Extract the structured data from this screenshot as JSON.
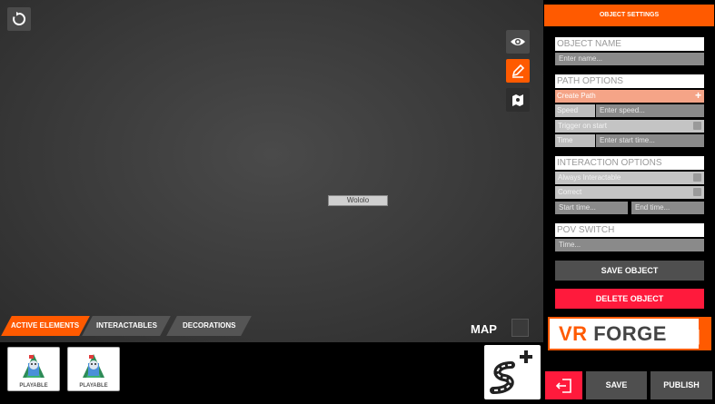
{
  "stage": {
    "node_label": "Wololo",
    "tabs": [
      {
        "label": "ACTIVE ELEMENTS",
        "active": true
      },
      {
        "label": "INTERACTABLES",
        "active": false
      },
      {
        "label": "DECORATIONS",
        "active": false
      }
    ],
    "map_label": "MAP",
    "tool_icons": [
      "reset-icon",
      "eye-icon",
      "pencil-icon",
      "map-marker-icon"
    ]
  },
  "tray": {
    "items": [
      {
        "label": "PLAYABLE"
      },
      {
        "label": "PLAYABLE"
      }
    ],
    "add_path_icon": "add-path-icon"
  },
  "panel": {
    "title": "OBJECT SETTINGS",
    "object_name": {
      "header": "OBJECT NAME",
      "placeholder": "Enter name..."
    },
    "path_options": {
      "header": "PATH OPTIONS",
      "create_label": "Create Path",
      "speed_label": "Speed",
      "speed_placeholder": "Enter speed...",
      "trigger_label": "Trigger on start",
      "time_label": "Time",
      "time_placeholder": "Enter start time..."
    },
    "interaction_options": {
      "header": "INTERACTION OPTIONS",
      "always_label": "Always Interactable",
      "correct_label": "Correct",
      "start_placeholder": "Start time...",
      "end_placeholder": "End time..."
    },
    "pov_switch": {
      "header": "POV SWITCH",
      "placeholder": "Time..."
    },
    "save_object": "SAVE OBJECT",
    "delete_object": "DELETE OBJECT",
    "logo": {
      "part1": "VR",
      "part2": "FORGE"
    },
    "save": "SAVE",
    "publish": "PUBLISH"
  },
  "colors": {
    "accent": "#ff5a00",
    "danger": "#ff1a3c",
    "button_gray": "#4f4f4f"
  }
}
